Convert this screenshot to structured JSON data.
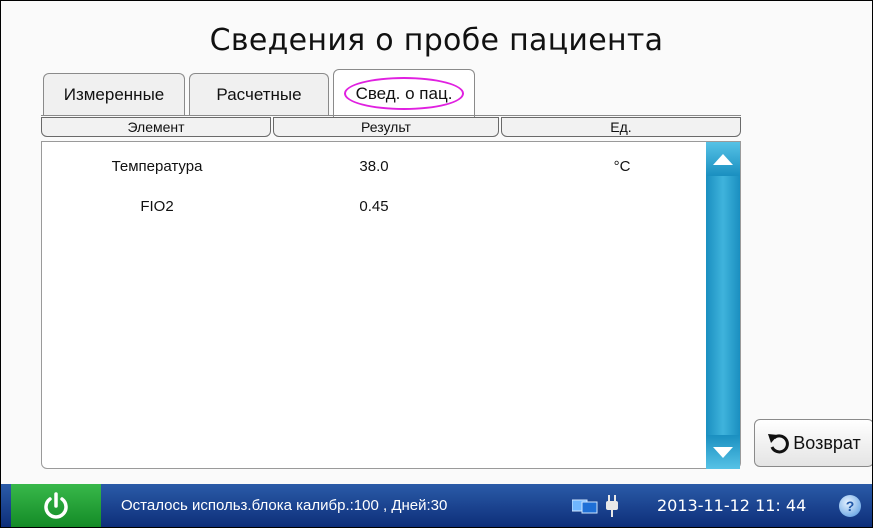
{
  "title": "Сведения о пробе пациента",
  "tabs": [
    {
      "label": "Измеренные"
    },
    {
      "label": "Расчетные"
    },
    {
      "label": "Свед. о пац."
    }
  ],
  "table": {
    "columns": [
      "Элемент",
      "Результ",
      "Ед."
    ],
    "rows": [
      {
        "element": "Температура",
        "result": "38.0",
        "unit": "°C"
      },
      {
        "element": "FIO2",
        "result": "0.45",
        "unit": ""
      }
    ]
  },
  "back_button": {
    "label": "Возврат"
  },
  "status_bar": {
    "message": "Осталось использ.блока калибр.:100 , Дней:30",
    "datetime": "2013-11-12  11: 44",
    "help_label": "?"
  },
  "colors": {
    "status_bar": "#0d2d78",
    "power_button": "#138a26",
    "scrollbar": "#1a8fc0",
    "active_tab_highlight": "#e020e0"
  },
  "icons": [
    "power-icon",
    "network-icon",
    "plug-icon",
    "help-icon",
    "back-arrow-icon",
    "scroll-up-icon",
    "scroll-down-icon"
  ]
}
